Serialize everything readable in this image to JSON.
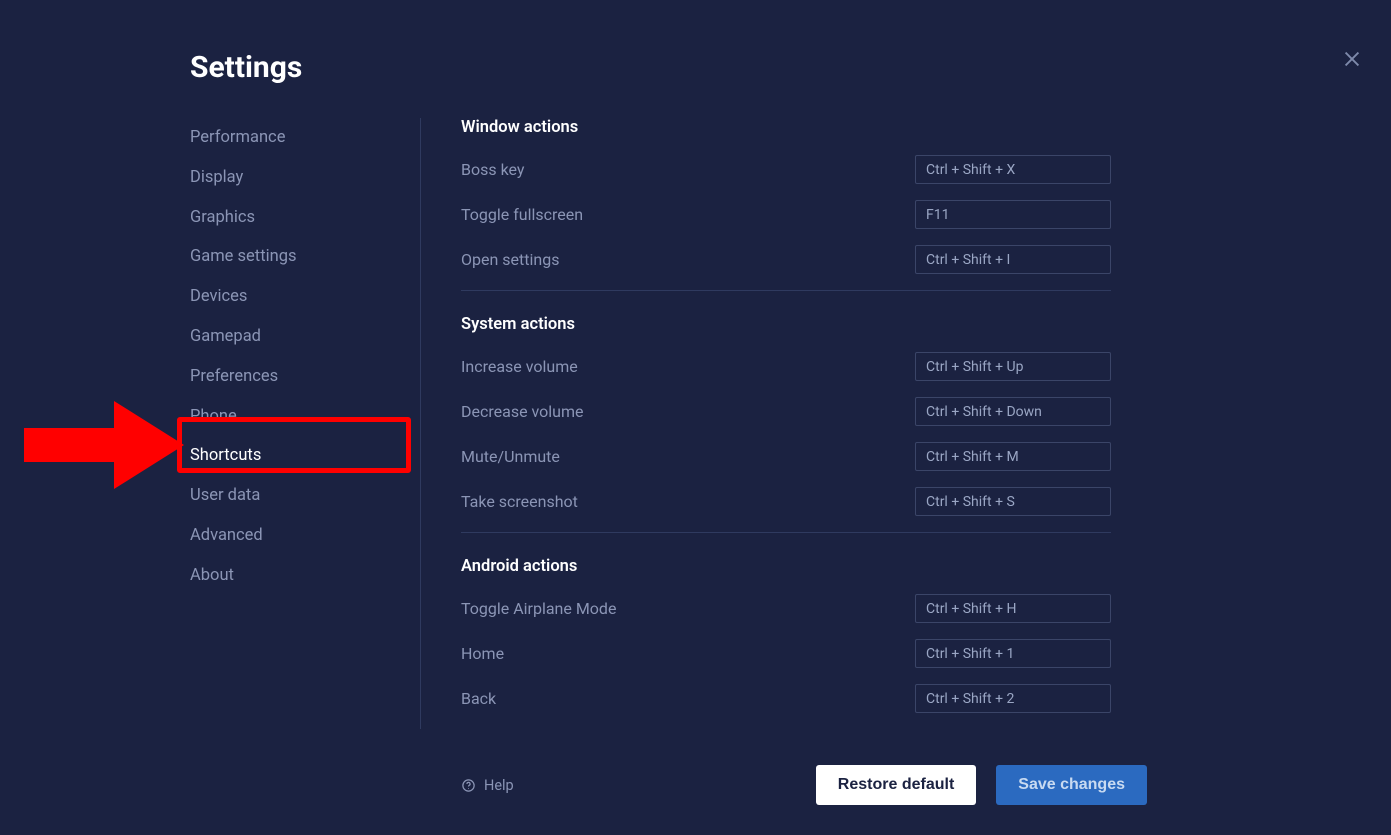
{
  "title": "Settings",
  "sidebar": {
    "items": [
      {
        "label": "Performance",
        "active": false
      },
      {
        "label": "Display",
        "active": false
      },
      {
        "label": "Graphics",
        "active": false
      },
      {
        "label": "Game settings",
        "active": false
      },
      {
        "label": "Devices",
        "active": false
      },
      {
        "label": "Gamepad",
        "active": false
      },
      {
        "label": "Preferences",
        "active": false
      },
      {
        "label": "Phone",
        "active": false
      },
      {
        "label": "Shortcuts",
        "active": true
      },
      {
        "label": "User data",
        "active": false
      },
      {
        "label": "Advanced",
        "active": false
      },
      {
        "label": "About",
        "active": false
      }
    ]
  },
  "sections": {
    "window": {
      "title": "Window actions",
      "rows": [
        {
          "label": "Boss key",
          "value": "Ctrl + Shift + X"
        },
        {
          "label": "Toggle fullscreen",
          "value": "F11"
        },
        {
          "label": "Open settings",
          "value": "Ctrl + Shift + I"
        }
      ]
    },
    "system": {
      "title": "System actions",
      "rows": [
        {
          "label": "Increase volume",
          "value": "Ctrl + Shift + Up"
        },
        {
          "label": "Decrease volume",
          "value": "Ctrl + Shift + Down"
        },
        {
          "label": "Mute/Unmute",
          "value": "Ctrl + Shift + M"
        },
        {
          "label": "Take screenshot",
          "value": "Ctrl + Shift + S"
        }
      ]
    },
    "android": {
      "title": "Android actions",
      "rows": [
        {
          "label": "Toggle Airplane Mode",
          "value": "Ctrl + Shift + H"
        },
        {
          "label": "Home",
          "value": "Ctrl + Shift + 1"
        },
        {
          "label": "Back",
          "value": "Ctrl + Shift + 2"
        }
      ]
    }
  },
  "footer": {
    "help": "Help",
    "restore": "Restore default",
    "save": "Save changes"
  }
}
